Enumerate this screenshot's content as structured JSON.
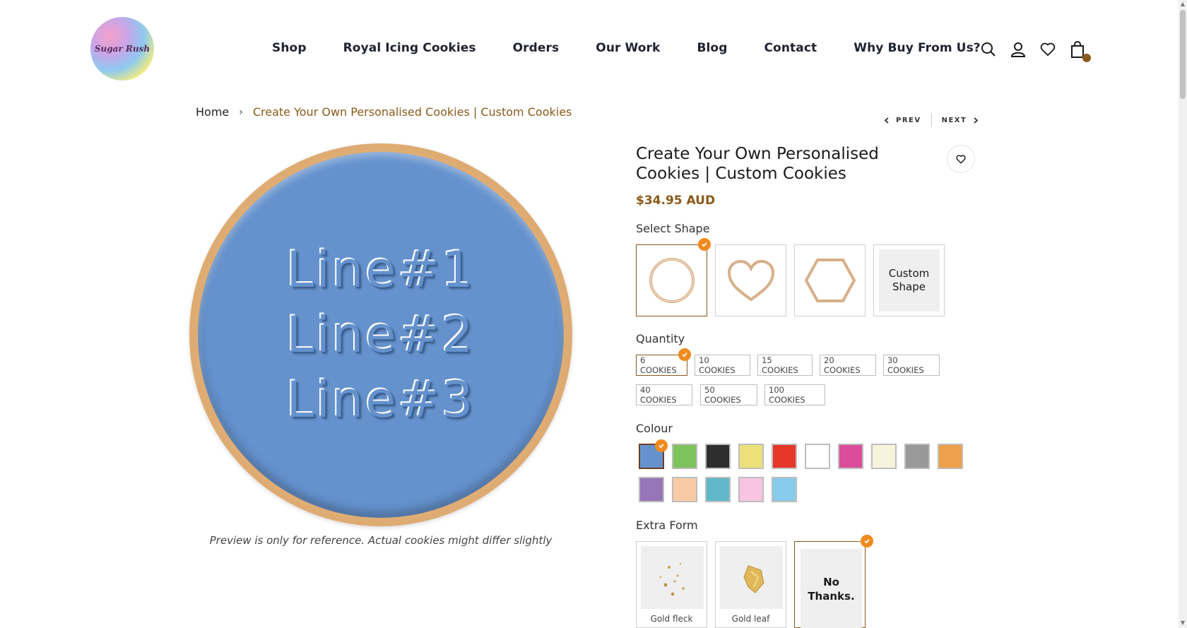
{
  "brand": {
    "logo_text": "Sugar Rush"
  },
  "nav": {
    "items": [
      "Shop",
      "Royal Icing Cookies",
      "Orders",
      "Our Work",
      "Blog",
      "Contact",
      "Why Buy From Us?"
    ]
  },
  "header_icons": [
    "search-icon",
    "user-icon",
    "heart-icon",
    "shopping-bag-icon"
  ],
  "breadcrumb": {
    "home": "Home",
    "separator": "›",
    "current": "Create Your Own Personalised Cookies | Custom Cookies"
  },
  "pager": {
    "prev": "PREV",
    "next": "NEXT"
  },
  "preview": {
    "lines": [
      "Line#1",
      "Line#2",
      "Line#3"
    ],
    "note": "Preview is only for reference. Actual cookies might differ slightly"
  },
  "product": {
    "title": "Create Your Own Personalised Cookies | Custom Cookies",
    "price": "$34.95 AUD"
  },
  "shape": {
    "label": "Select Shape",
    "options": [
      "circle",
      "heart",
      "hexagon",
      "Custom Shape"
    ],
    "selected": "circle"
  },
  "quantity": {
    "label": "Quantity",
    "options": [
      "6 COOKIES",
      "10 COOKIES",
      "15 COOKIES",
      "20 COOKIES",
      "30 COOKIES",
      "40 COOKIES",
      "50 COOKIES",
      "100 COOKIES"
    ],
    "selected": "6 COOKIES"
  },
  "colour": {
    "label": "Colour",
    "swatches": [
      "#6592cd",
      "#7cc35a",
      "#2e2e2e",
      "#ebe07a",
      "#e8362a",
      "#ffffff",
      "#db4c9a",
      "#f6f4dc",
      "#999999",
      "#eea04a",
      "#9676b8",
      "#f8cba6",
      "#5fb8cc",
      "#f9c4e2",
      "#86cbea"
    ],
    "selected_index": 0
  },
  "extra_form": {
    "label": "Extra Form",
    "options": [
      "Gold fleck",
      "Gold leaf",
      "No Thanks."
    ],
    "selected": "No Thanks."
  },
  "colors": {
    "accent": "#8a5a1a",
    "check": "#f08a1e"
  }
}
